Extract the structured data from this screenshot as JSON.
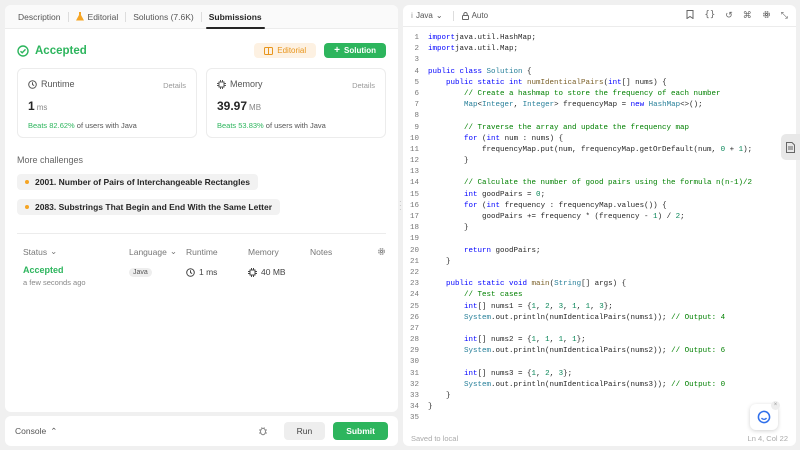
{
  "tabs": {
    "description": "Description",
    "editorial": "Editorial",
    "solutions": "Solutions (7.6K)",
    "submissions": "Submissions"
  },
  "result": {
    "status": "Accepted",
    "editorial_btn": "Editorial",
    "solution_btn": "Solution"
  },
  "runtime": {
    "title": "Runtime",
    "details": "Details",
    "value": "1",
    "unit": "ms",
    "beats": "Beats 82.62%",
    "beats_suffix": "of users with Java"
  },
  "memory": {
    "title": "Memory",
    "details": "Details",
    "value": "39.97",
    "unit": "MB",
    "beats": "Beats 53.83%",
    "beats_suffix": "of users with Java"
  },
  "more_challenges": {
    "title": "More challenges",
    "items": [
      "2001. Number of Pairs of Interchangeable Rectangles",
      "2083. Substrings That Begin and End With the Same Letter"
    ]
  },
  "table": {
    "headers": {
      "status": "Status",
      "language": "Language",
      "runtime": "Runtime",
      "memory": "Memory",
      "notes": "Notes"
    },
    "rows": [
      {
        "status": "Accepted",
        "time": "a few seconds ago",
        "language": "Java",
        "runtime": "1 ms",
        "memory": "40 MB"
      }
    ]
  },
  "bottom": {
    "console": "Console",
    "run": "Run",
    "submit": "Submit"
  },
  "editor": {
    "language": "Java",
    "mode": "Auto",
    "saved": "Saved to local",
    "cursor": "Ln 4, Col 22"
  },
  "colors": {
    "accent_green": "#2db55d",
    "editorial_orange": "#e8951b"
  },
  "code_lines": [
    [
      [
        "kw",
        "import"
      ],
      [
        "",
        "java.util.HashMap;"
      ]
    ],
    [
      [
        "kw",
        "import"
      ],
      [
        "",
        "java.util.Map;"
      ]
    ],
    [],
    [
      [
        "kw",
        "public class"
      ],
      [
        "",
        " "
      ],
      [
        "ty",
        "Solution"
      ],
      [
        "",
        " {"
      ]
    ],
    [
      [
        "",
        "    "
      ],
      [
        "kw",
        "public static int"
      ],
      [
        "",
        " "
      ],
      [
        "fn",
        "numIdenticalPairs"
      ],
      [
        "",
        "("
      ],
      [
        "kw",
        "int"
      ],
      [
        "",
        "[] nums) {"
      ]
    ],
    [
      [
        "",
        "        "
      ],
      [
        "cm",
        "// Create a hashmap to store the frequency of each number"
      ]
    ],
    [
      [
        "",
        "        "
      ],
      [
        "ty",
        "Map"
      ],
      [
        "",
        "<"
      ],
      [
        "ty",
        "Integer"
      ],
      [
        ", "
      ],
      [
        "ty",
        "Integer"
      ],
      [
        "",
        "> frequencyMap = "
      ],
      [
        "kw",
        "new"
      ],
      [
        "",
        " "
      ],
      [
        "ty",
        "HashMap"
      ],
      [
        "",
        "<>();"
      ]
    ],
    [],
    [
      [
        "",
        "        "
      ],
      [
        "cm",
        "// Traverse the array and update the frequency map"
      ]
    ],
    [
      [
        "",
        "        "
      ],
      [
        "kw",
        "for"
      ],
      [
        "",
        " ("
      ],
      [
        "kw",
        "int"
      ],
      [
        "",
        " num : nums) {"
      ]
    ],
    [
      [
        "",
        "            frequencyMap.put(num, frequencyMap.getOrDefault(num, "
      ],
      [
        "nm",
        "0"
      ],
      [
        "",
        " + "
      ],
      [
        "nm",
        "1"
      ],
      [
        "",
        ");"
      ]
    ],
    [
      [
        "",
        "        }"
      ]
    ],
    [],
    [
      [
        "",
        "        "
      ],
      [
        "cm",
        "// Calculate the number of good pairs using the formula n(n-1)/2"
      ]
    ],
    [
      [
        "",
        "        "
      ],
      [
        "kw",
        "int"
      ],
      [
        "",
        " goodPairs = "
      ],
      [
        "nm",
        "0"
      ],
      [
        "",
        ";"
      ]
    ],
    [
      [
        "",
        "        "
      ],
      [
        "kw",
        "for"
      ],
      [
        "",
        " ("
      ],
      [
        "kw",
        "int"
      ],
      [
        "",
        " frequency : frequencyMap.values()) {"
      ]
    ],
    [
      [
        "",
        "            goodPairs += frequency * (frequency - "
      ],
      [
        "nm",
        "1"
      ],
      [
        "",
        ") / "
      ],
      [
        "nm",
        "2"
      ],
      [
        "",
        ";"
      ]
    ],
    [
      [
        "",
        "        }"
      ]
    ],
    [],
    [
      [
        "",
        "        "
      ],
      [
        "kw",
        "return"
      ],
      [
        "",
        " goodPairs;"
      ]
    ],
    [
      [
        "",
        "    }"
      ]
    ],
    [],
    [
      [
        "",
        "    "
      ],
      [
        "kw",
        "public static void"
      ],
      [
        "",
        " "
      ],
      [
        "fn",
        "main"
      ],
      [
        "",
        "("
      ],
      [
        "ty",
        "String"
      ],
      [
        "",
        "[] args) {"
      ]
    ],
    [
      [
        "",
        "        "
      ],
      [
        "cm",
        "// Test cases"
      ]
    ],
    [
      [
        "",
        "        "
      ],
      [
        "kw",
        "int"
      ],
      [
        "",
        "[] nums1 = {"
      ],
      [
        "nm",
        "1"
      ],
      [
        ", "
      ],
      [
        "nm",
        "2"
      ],
      [
        ", "
      ],
      [
        "nm",
        "3"
      ],
      [
        ", "
      ],
      [
        "nm",
        "1"
      ],
      [
        ", "
      ],
      [
        "nm",
        "1"
      ],
      [
        ", "
      ],
      [
        "nm",
        "3"
      ],
      [
        "",
        "};"
      ]
    ],
    [
      [
        "",
        "        "
      ],
      [
        "ty",
        "System"
      ],
      [
        "",
        ".out.println(numIdenticalPairs(nums1)); "
      ],
      [
        "cm",
        "// Output: 4"
      ]
    ],
    [],
    [
      [
        "",
        "        "
      ],
      [
        "kw",
        "int"
      ],
      [
        "",
        "[] nums2 = {"
      ],
      [
        "nm",
        "1"
      ],
      [
        ", "
      ],
      [
        "nm",
        "1"
      ],
      [
        ", "
      ],
      [
        "nm",
        "1"
      ],
      [
        ", "
      ],
      [
        "nm",
        "1"
      ],
      [
        "",
        "};"
      ]
    ],
    [
      [
        "",
        "        "
      ],
      [
        "ty",
        "System"
      ],
      [
        "",
        ".out.println(numIdenticalPairs(nums2)); "
      ],
      [
        "cm",
        "// Output: 6"
      ]
    ],
    [],
    [
      [
        "",
        "        "
      ],
      [
        "kw",
        "int"
      ],
      [
        "",
        "[] nums3 = {"
      ],
      [
        "nm",
        "1"
      ],
      [
        ", "
      ],
      [
        "nm",
        "2"
      ],
      [
        ", "
      ],
      [
        "nm",
        "3"
      ],
      [
        "",
        "};"
      ]
    ],
    [
      [
        "",
        "        "
      ],
      [
        "ty",
        "System"
      ],
      [
        "",
        ".out.println(numIdenticalPairs(nums3)); "
      ],
      [
        "cm",
        "// Output: 0"
      ]
    ],
    [
      [
        "",
        "    }"
      ]
    ],
    [
      [
        "",
        "}"
      ]
    ],
    []
  ]
}
